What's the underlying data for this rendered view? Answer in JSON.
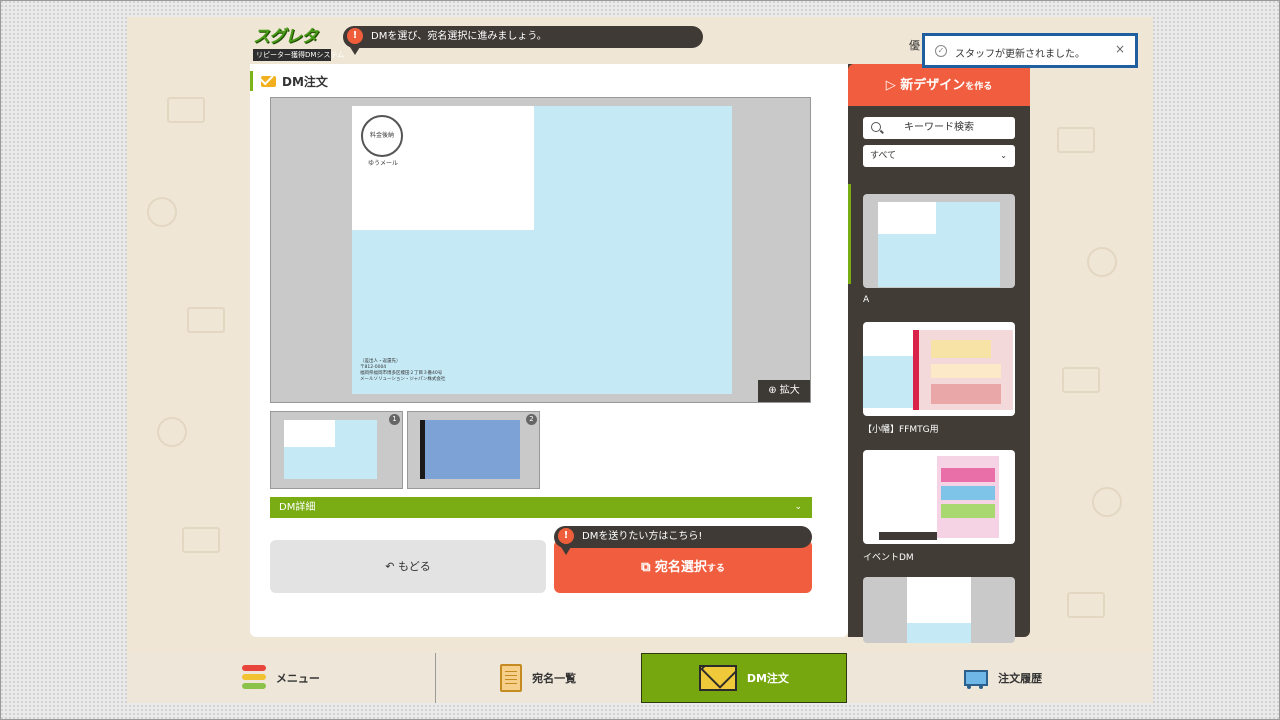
{
  "header": {
    "logo_text": "スグレタ",
    "logo_sub": "リピーター獲得DMシステム",
    "hint": "DMを選び、宛名選択に進みましょう。",
    "user_label": "優"
  },
  "toast": {
    "message": "スタッフが更新されました。",
    "close": "×"
  },
  "main": {
    "title": "DM注文",
    "zoom_label": "拡大",
    "postcard": {
      "stamp": "料金後納",
      "stamp_sub": "ゆうメール",
      "address": "（差出人・返還先）\n〒812-0004\n福岡県福岡市博多区榎田２丁目３番40号\nメールソリューション・ジャパン株式会社"
    },
    "thumbs": [
      {
        "number": "1"
      },
      {
        "number": "2"
      }
    ],
    "details_label": "DM詳細",
    "send_hint": "DMを送りたい方はこちら!",
    "back_label": "もどる",
    "next_label": "宛名選択",
    "next_suffix": "する"
  },
  "side": {
    "new_design_label": "新デザイン",
    "new_design_suffix": "を作る",
    "search_placeholder": "キーワード検索",
    "filter_value": "すべて",
    "templates": [
      {
        "name": "A"
      },
      {
        "name": "【小幡】FFMTG用"
      },
      {
        "name": "イベントDM"
      },
      {
        "name": ""
      }
    ]
  },
  "footer": {
    "items": [
      {
        "label": "メニュー"
      },
      {
        "label": "宛名一覧"
      },
      {
        "label": "DM注文"
      },
      {
        "label": "注文履歴"
      }
    ]
  },
  "colors": {
    "accent_green": "#7aad14",
    "accent_orange": "#f15e3f",
    "dark_panel": "#413c36",
    "postcard_blue": "#c6e9f6"
  }
}
